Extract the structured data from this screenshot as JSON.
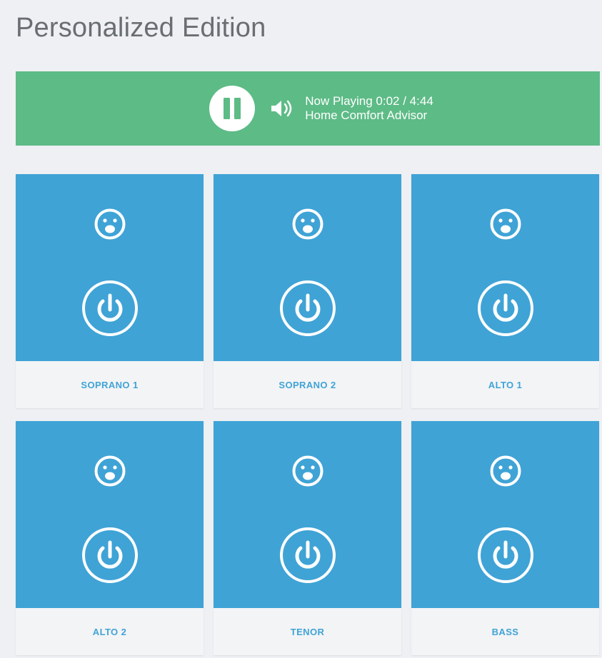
{
  "page": {
    "title": "Personalized Edition"
  },
  "player": {
    "status": "Now Playing 0:02 / 4:44",
    "track": "Home Comfort Advisor",
    "pause_icon": "pause-icon",
    "volume_icon": "volume-icon",
    "bar_color": "#5dbb86"
  },
  "voices": [
    {
      "label": "SOPRANO 1",
      "face_icon": "face-icon",
      "power_icon": "power-icon"
    },
    {
      "label": "SOPRANO 2",
      "face_icon": "face-icon",
      "power_icon": "power-icon"
    },
    {
      "label": "ALTO 1",
      "face_icon": "face-icon",
      "power_icon": "power-icon"
    },
    {
      "label": "ALTO 2",
      "face_icon": "face-icon",
      "power_icon": "power-icon"
    },
    {
      "label": "TENOR",
      "face_icon": "face-icon",
      "power_icon": "power-icon"
    },
    {
      "label": "BASS",
      "face_icon": "face-icon",
      "power_icon": "power-icon"
    }
  ],
  "colors": {
    "card_accent": "#3fa3d6",
    "background": "#eef0f3"
  }
}
